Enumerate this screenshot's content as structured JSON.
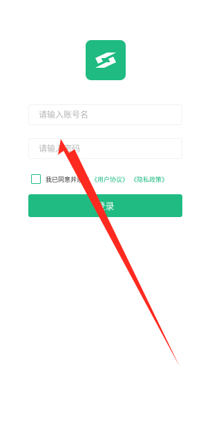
{
  "logo": {
    "icon": "app-logo-icon",
    "color": "#1fbb82"
  },
  "login_form": {
    "username_placeholder": "请输入账号名",
    "password_placeholder": "请输入密码",
    "agreement_text": "我已同意并遵守",
    "user_agreement_link": "《用户协议》",
    "privacy_policy_link": "《隐私政策》",
    "login_button": "登录"
  },
  "colors": {
    "accent": "#1fbb82",
    "annotation_arrow": "#ff2a1f"
  }
}
